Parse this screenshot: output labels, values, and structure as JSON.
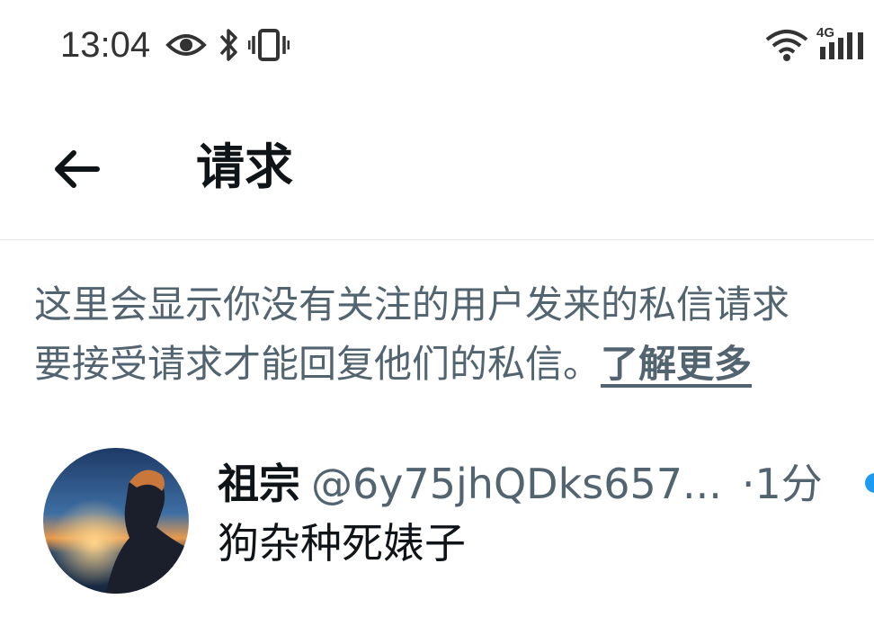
{
  "status_bar": {
    "time": "13:04",
    "icons": [
      "eye-icon",
      "bluetooth-icon",
      "vibrate-icon",
      "wifi-icon",
      "signal-4g-icon"
    ],
    "network_label": "4G"
  },
  "header": {
    "back_icon": "arrow-left-icon",
    "title": "请求"
  },
  "info": {
    "line1": "这里会显示你没有关注的用户发来的私信请求",
    "line2": "要接受请求才能回复他们的私信。",
    "learn_more": "了解更多"
  },
  "requests": [
    {
      "display_name": "祖宗",
      "handle": "@6y75jhQDks657...",
      "separator": "·",
      "time_ago": "1分",
      "message": "狗杂种死婊子",
      "unread": true
    }
  ],
  "colors": {
    "text_primary": "#0f1419",
    "text_secondary": "#536471",
    "accent": "#1d9bf0",
    "divider": "#e1e4e8"
  }
}
